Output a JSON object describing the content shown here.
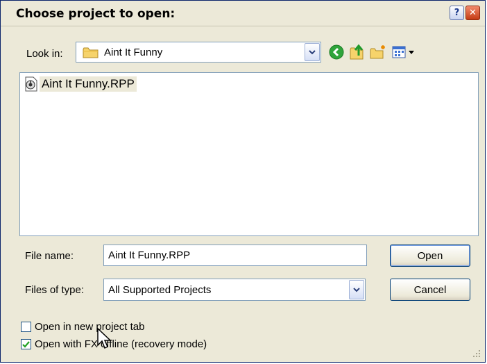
{
  "dialog": {
    "title": "Choose project to open:",
    "help_glyph": "?",
    "close_glyph": "✕"
  },
  "lookin": {
    "label": "Look in:",
    "value": "Aint It Funny",
    "icon": "folder-icon"
  },
  "toolbar": {
    "back_icon": "back-arrow-icon",
    "up_icon": "up-one-level-icon",
    "newfolder_icon": "new-folder-icon",
    "views_icon": "view-menu-icon"
  },
  "files": [
    {
      "name": "Aint It Funny.RPP",
      "icon": "reaper-project-file-icon"
    }
  ],
  "filename": {
    "label": "File name:",
    "value": "Aint It Funny.RPP"
  },
  "filetype": {
    "label": "Files of type:",
    "value": "All Supported Projects"
  },
  "buttons": {
    "open": "Open",
    "cancel": "Cancel"
  },
  "options": [
    {
      "label": "Open in new project tab",
      "checked": false
    },
    {
      "label": "Open with FX offline (recovery mode)",
      "checked": true
    }
  ],
  "colors": {
    "dialog_bg": "#ece9d8",
    "border_blue": "#7f9db9",
    "close_red": "#c43c14",
    "check_green": "#21a121"
  }
}
